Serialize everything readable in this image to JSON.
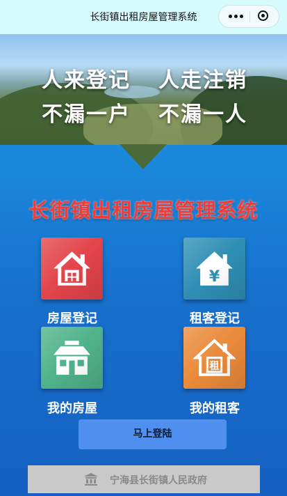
{
  "window": {
    "title": "长街镇出租房屋管理系统",
    "more_icon": "more-dots-icon",
    "close_icon": "target-circle-icon"
  },
  "banner": {
    "slogans": [
      "人来登记",
      "人走注销",
      "不漏一户",
      "不漏一人"
    ]
  },
  "system_title": "长街镇出租房屋管理系统",
  "menu": [
    {
      "label": "房屋登记",
      "icon": "house-icon",
      "color": "#e2444a"
    },
    {
      "label": "租客登记",
      "icon": "house-yen-icon",
      "color": "#2f8fb4"
    },
    {
      "label": "我的房屋",
      "icon": "house-windows-icon",
      "color": "#4fb28a"
    },
    {
      "label": "我的租客",
      "icon": "house-rent-icon",
      "color": "#ea8a3a",
      "icon_char": "租"
    }
  ],
  "menu_yen_char": "¥",
  "login_button": "马上登陆",
  "footer": {
    "text": "宁海县长街镇人民政府",
    "icon": "government-building-icon"
  }
}
